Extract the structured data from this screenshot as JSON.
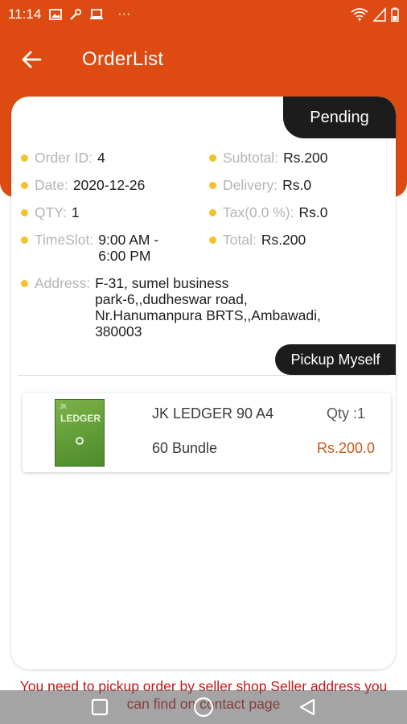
{
  "status_bar": {
    "time": "11:14",
    "more": "···"
  },
  "topbar": {
    "title": "OrderList"
  },
  "order": {
    "status": "Pending",
    "fields": {
      "order_id": {
        "label": "Order ID:",
        "value": "4"
      },
      "date": {
        "label": "Date:",
        "value": "2020-12-26"
      },
      "qty": {
        "label": "QTY:",
        "value": "1"
      },
      "timeslot": {
        "label": "TimeSlot:",
        "value_line1": "9:00 AM -",
        "value_line2": "6:00 PM"
      },
      "address": {
        "label": "Address:",
        "lines": [
          "F-31, sumel business",
          "park-6,,dudheswar road,",
          "Nr.Hanumanpura BRTS,,Ambawadi,",
          "380003"
        ]
      },
      "subtotal": {
        "label": "Subtotal:",
        "value": "Rs.200"
      },
      "delivery": {
        "label": "Delivery:",
        "value": "Rs.0"
      },
      "tax": {
        "label": "Tax(0.0 %):",
        "value": "Rs.0"
      },
      "total": {
        "label": "Total:",
        "value": "Rs.200"
      }
    },
    "delivery_type": "Pickup Myself"
  },
  "items": [
    {
      "name": "JK LEDGER 90 A4",
      "qty": "Qty :1",
      "unit": "60 Bundle",
      "price": "Rs.200.0",
      "thumb_text_small": "JK",
      "thumb_text": "LEDGER"
    }
  ],
  "notice": "You need to pickup order by seller shop Seller address you can find on contact page",
  "colors": {
    "primary": "#dd4b12",
    "badge": "#1c1c1c",
    "dot": "#f4c22b",
    "price": "#c65a1e",
    "notice": "#c0181a"
  }
}
